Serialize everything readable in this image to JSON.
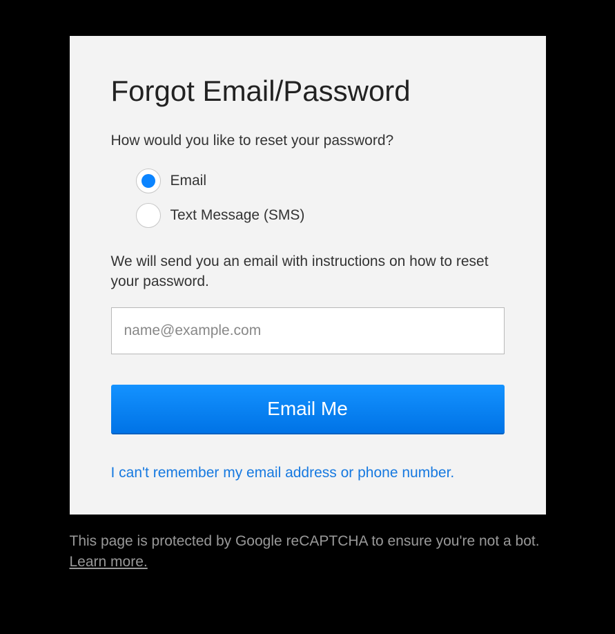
{
  "card": {
    "title": "Forgot Email/Password",
    "prompt": "How would you like to reset your password?",
    "options": [
      {
        "label": "Email",
        "selected": true
      },
      {
        "label": "Text Message (SMS)",
        "selected": false
      }
    ],
    "description": "We will send you an email with instructions on how to reset your password.",
    "input": {
      "placeholder": "name@example.com",
      "value": ""
    },
    "submit_label": "Email Me",
    "forgot_link": "I can't remember my email address or phone number."
  },
  "footer": {
    "text": "This page is protected by Google reCAPTCHA to ensure you're not a bot. ",
    "learn_more": "Learn more."
  }
}
